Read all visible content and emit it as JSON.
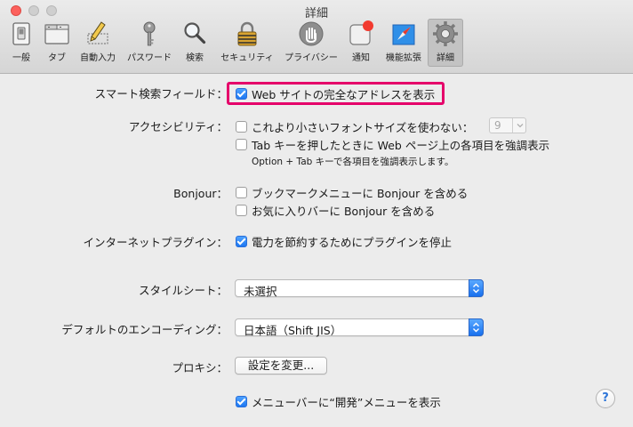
{
  "window": {
    "title": "詳細"
  },
  "toolbar": {
    "items": [
      {
        "label": "一般",
        "icon": "general-switch-icon"
      },
      {
        "label": "タブ",
        "icon": "tabs-icon"
      },
      {
        "label": "自動入力",
        "icon": "autofill-pencil-icon"
      },
      {
        "label": "パスワード",
        "icon": "key-icon"
      },
      {
        "label": "検索",
        "icon": "magnifier-icon"
      },
      {
        "label": "セキュリティ",
        "icon": "padlock-icon"
      },
      {
        "label": "プライバシー",
        "icon": "hand-icon"
      },
      {
        "label": "通知",
        "icon": "notification-badge-icon"
      },
      {
        "label": "機能拡張",
        "icon": "extensions-compass-icon"
      },
      {
        "label": "詳細",
        "icon": "gear-icon",
        "selected": true
      }
    ]
  },
  "smart_search": {
    "label": "スマート検索フィールド：",
    "show_full_address": {
      "text": "Web サイトの完全なアドレスを表示",
      "checked": true
    }
  },
  "accessibility": {
    "label": "アクセシビリティ：",
    "min_font": {
      "text": "これより小さいフォントサイズを使わない：",
      "checked": false,
      "value": "9"
    },
    "tab_highlight": {
      "text": "Tab キーを押したときに Web ページ上の各項目を強調表示",
      "checked": false
    },
    "note": "Option + Tab キーで各項目を強調表示します。"
  },
  "bonjour": {
    "label": "Bonjour：",
    "bookmarks_menu": {
      "text": "ブックマークメニューに Bonjour を含める",
      "checked": false
    },
    "favorites_bar": {
      "text": "お気に入りバーに Bonjour を含める",
      "checked": false
    }
  },
  "internet_plugins": {
    "label": "インターネットプラグイン：",
    "stop_plugins": {
      "text": "電力を節約するためにプラグインを停止",
      "checked": true
    }
  },
  "style_sheet": {
    "label": "スタイルシート：",
    "value": "未選択"
  },
  "default_encoding": {
    "label": "デフォルトのエンコーディング：",
    "value": "日本語（Shift JIS）"
  },
  "proxy": {
    "label": "プロキシ：",
    "button": "設定を変更..."
  },
  "develop_menu": {
    "text": "メニューバーに“開発”メニューを表示",
    "checked": true
  },
  "help": {
    "label": "?"
  },
  "colors": {
    "highlight_border": "#e5006a",
    "accent": "#1d77f2"
  }
}
